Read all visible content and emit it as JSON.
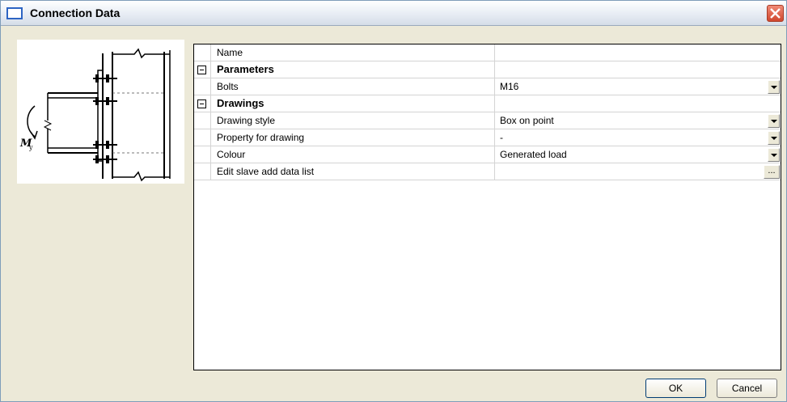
{
  "window": {
    "title": "Connection Data"
  },
  "preview": {
    "moment_label": "M",
    "moment_subscript": "y"
  },
  "grid": {
    "rows": [
      {
        "kind": "property",
        "label": "Name",
        "value": "",
        "editor": "none"
      },
      {
        "kind": "category",
        "label": "Parameters"
      },
      {
        "kind": "property",
        "label": "Bolts",
        "value": "M16",
        "editor": "dropdown"
      },
      {
        "kind": "category",
        "label": "Drawings"
      },
      {
        "kind": "property",
        "label": "Drawing style",
        "value": "Box on point",
        "editor": "dropdown"
      },
      {
        "kind": "property",
        "label": "Property for drawing",
        "value": "-",
        "editor": "dropdown"
      },
      {
        "kind": "property",
        "label": "Colour",
        "value": "Generated load",
        "editor": "dropdown"
      },
      {
        "kind": "property",
        "label": "Edit slave add data list",
        "value": "",
        "editor": "ellipsis"
      }
    ],
    "ellipsis_glyph": "..."
  },
  "buttons": {
    "ok": "OK",
    "cancel": "Cancel"
  }
}
